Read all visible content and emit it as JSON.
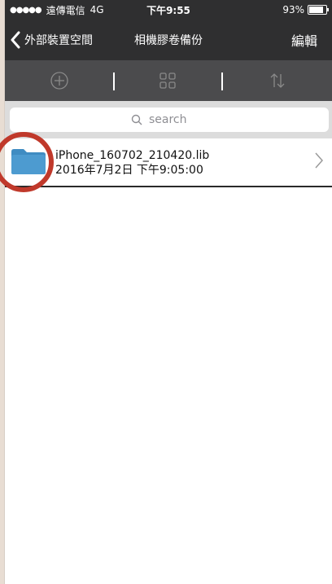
{
  "status": {
    "carrier_dots": "●●●●●",
    "carrier": "遠傳電信",
    "network": "4G",
    "time": "下午9:55",
    "battery_text": "93%",
    "battery_level": 0.93
  },
  "navbar": {
    "back_label": "外部裝置空間",
    "title": "相機膠卷備份",
    "edit_label": "編輯"
  },
  "toolbar": {
    "icons": [
      "plus-circle-icon",
      "grid-icon",
      "sort-icon"
    ]
  },
  "search": {
    "placeholder": "search"
  },
  "files": [
    {
      "name": "iPhone_160702_210420.lib",
      "date": "2016年7月2日 下午9:05:00",
      "icon": "folder-icon"
    }
  ],
  "colors": {
    "nav_bg": "#2f2f30",
    "toolbar_bg": "#4b4b4d",
    "folder": "#4d9bd0",
    "annotation": "#c0392b"
  }
}
